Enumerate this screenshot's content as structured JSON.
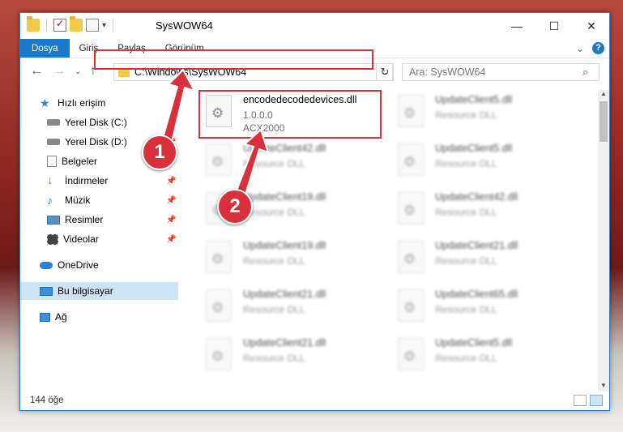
{
  "window": {
    "title": "SysWOW64",
    "minimize": "—",
    "maximize": "☐",
    "close": "✕"
  },
  "ribbon": {
    "tabs": [
      "Dosya",
      "Giriş",
      "Paylaş",
      "Görünüm"
    ],
    "expand": "⌄",
    "help": "?"
  },
  "address": {
    "back": "←",
    "forward": "→",
    "recent": "⌄",
    "up": "↑",
    "path": "C:\\Windows\\SysWOW64",
    "dropdown": "⌄",
    "refresh": "↻"
  },
  "search": {
    "placeholder": "Ara: SysWOW64",
    "icon": "⌕"
  },
  "sidebar": {
    "items": [
      {
        "label": "Hızlı erişim",
        "icon": "star-icon"
      },
      {
        "label": "Yerel Disk (C:)",
        "icon": "drive-icon"
      },
      {
        "label": "Yerel Disk (D:)",
        "icon": "drive-icon"
      },
      {
        "label": "Belgeler",
        "icon": "documents-icon"
      },
      {
        "label": "İndirmeler",
        "icon": "download-icon"
      },
      {
        "label": "Müzik",
        "icon": "music-icon"
      },
      {
        "label": "Resimler",
        "icon": "pictures-icon"
      },
      {
        "label": "Videolar",
        "icon": "video-icon"
      },
      {
        "label": "OneDrive",
        "icon": "cloud-icon"
      },
      {
        "label": "Bu bilgisayar",
        "icon": "computer-icon"
      },
      {
        "label": "Ağ",
        "icon": "network-icon"
      }
    ]
  },
  "files": [
    {
      "name": "encodedecodedevices.dll",
      "line2": "1.0.0.0",
      "line3": "ACX2000"
    },
    {
      "name": "UpdateClient5.dll",
      "line2": "Resource DLL"
    },
    {
      "name": "UpdateClient42.dll",
      "line2": "Resource DLL"
    },
    {
      "name": "UpdateClient5.dll",
      "line2": "Resource DLL"
    },
    {
      "name": "UpdateClient19.dll",
      "line2": "Resource DLL"
    },
    {
      "name": "UpdateClient42.dll",
      "line2": "Resource DLL"
    },
    {
      "name": "UpdateClient19.dll",
      "line2": "Resource DLL"
    },
    {
      "name": "UpdateClient21.dll",
      "line2": "Resource DLL"
    },
    {
      "name": "UpdateClient21.dll",
      "line2": "Resource DLL"
    },
    {
      "name": "UpdateClient65.dll",
      "line2": "Resource DLL"
    },
    {
      "name": "UpdateClient21.dll",
      "line2": "Resource DLL"
    },
    {
      "name": "UpdateClient5.dll",
      "line2": "Resource DLL"
    }
  ],
  "status": {
    "count": "144 öğe"
  },
  "callouts": {
    "one": "1",
    "two": "2"
  },
  "colors": {
    "accent": "#1979ca",
    "highlight": "#d8313c"
  }
}
